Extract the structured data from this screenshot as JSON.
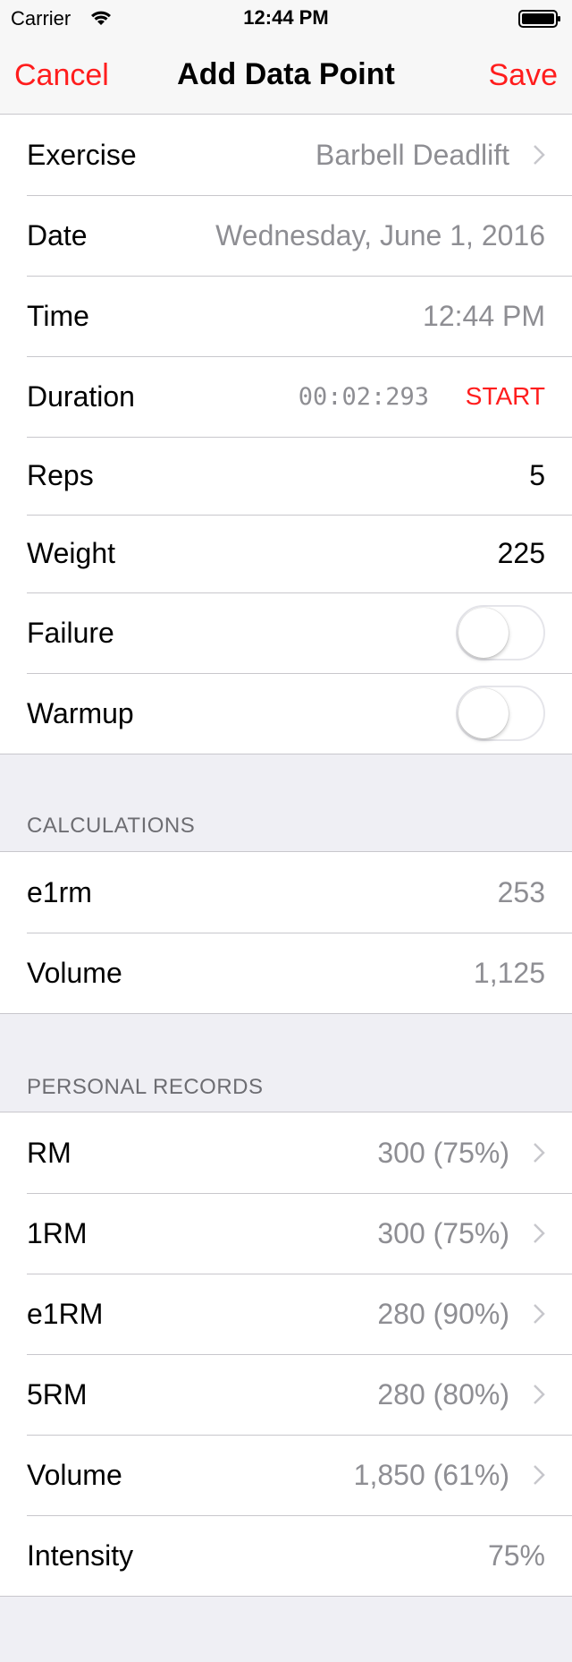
{
  "status_bar": {
    "carrier": "Carrier",
    "time": "12:44 PM"
  },
  "nav": {
    "cancel": "Cancel",
    "title": "Add Data Point",
    "save": "Save"
  },
  "form": {
    "exercise": {
      "label": "Exercise",
      "value": "Barbell Deadlift"
    },
    "date": {
      "label": "Date",
      "value": "Wednesday, June 1, 2016"
    },
    "time": {
      "label": "Time",
      "value": "12:44 PM"
    },
    "duration": {
      "label": "Duration",
      "value": "00:02:293",
      "action": "START"
    },
    "reps": {
      "label": "Reps",
      "value": "5"
    },
    "weight": {
      "label": "Weight",
      "value": "225"
    },
    "failure": {
      "label": "Failure",
      "on": false
    },
    "warmup": {
      "label": "Warmup",
      "on": false
    }
  },
  "calculations": {
    "header": "CALCULATIONS",
    "rows": [
      {
        "label": "e1rm",
        "value": "253"
      },
      {
        "label": "Volume",
        "value": "1,125"
      }
    ]
  },
  "personal_records": {
    "header": "PERSONAL RECORDS",
    "rows": [
      {
        "label": "RM",
        "value": "300 (75%)"
      },
      {
        "label": "1RM",
        "value": "300 (75%)"
      },
      {
        "label": "e1RM",
        "value": "280 (90%)"
      },
      {
        "label": "5RM",
        "value": "280 (80%)"
      },
      {
        "label": "Volume",
        "value": "1,850 (61%)"
      },
      {
        "label": "Intensity",
        "value": "75%"
      }
    ]
  },
  "colors": {
    "accent": "#ff1d1d",
    "secondary_text": "#8e8e93",
    "background": "#efeff4"
  }
}
